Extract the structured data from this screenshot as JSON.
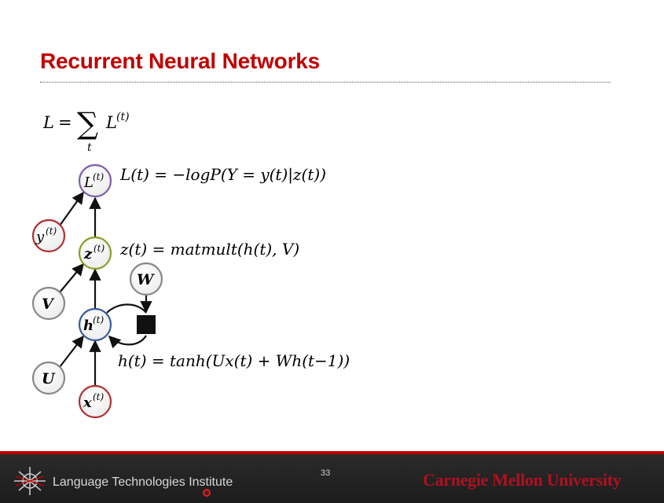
{
  "slide": {
    "title": "Recurrent Neural Networks",
    "page_number": "33"
  },
  "equations": {
    "loss_sum": {
      "lhs": "L",
      "eq": "=",
      "sigma": "∑",
      "sub": "t",
      "term": "L",
      "sup": "(t)"
    },
    "loss_t": "L(t) = −logP(Y = y(t)|z(t))",
    "z_t": "z(t) = matmult(h(t), V)",
    "h_t": "h(t) = tanh(Ux(t) + Wh(t−1))"
  },
  "nodes": {
    "L": {
      "label": "L",
      "sup": "(t)",
      "color": "#7b5ea7"
    },
    "y": {
      "label": "y",
      "sup": "(t)",
      "color": "#b03030"
    },
    "z": {
      "label": "z",
      "sup": "(t)",
      "color": "#8f9a2a"
    },
    "V": {
      "label": "V",
      "sup": "",
      "color": "#888888"
    },
    "W": {
      "label": "W",
      "sup": "",
      "color": "#888888"
    },
    "h": {
      "label": "h",
      "sup": "(t)",
      "color": "#3a5a9a"
    },
    "U": {
      "label": "U",
      "sup": "",
      "color": "#888888"
    },
    "x": {
      "label": "x",
      "sup": "(t)",
      "color": "#b03030"
    }
  },
  "footer": {
    "institute": "Language Technologies Institute",
    "university": "Carnegie Mellon University",
    "accent_color": "#c00000"
  }
}
